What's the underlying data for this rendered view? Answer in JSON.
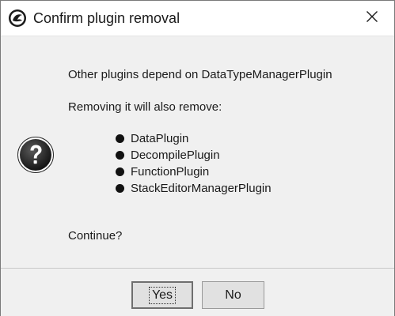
{
  "window": {
    "title": "Confirm plugin removal",
    "app_icon": "dragon-icon",
    "close_icon": "close-icon"
  },
  "dialog": {
    "icon": "question-icon",
    "message_line1": "Other plugins depend on DataTypeManagerPlugin",
    "message_line2": "Removing it will also remove:",
    "dependents": [
      "DataPlugin",
      "DecompilePlugin",
      "FunctionPlugin",
      "StackEditorManagerPlugin"
    ],
    "prompt": "Continue?"
  },
  "buttons": {
    "yes_label": "Yes",
    "no_label": "No"
  }
}
